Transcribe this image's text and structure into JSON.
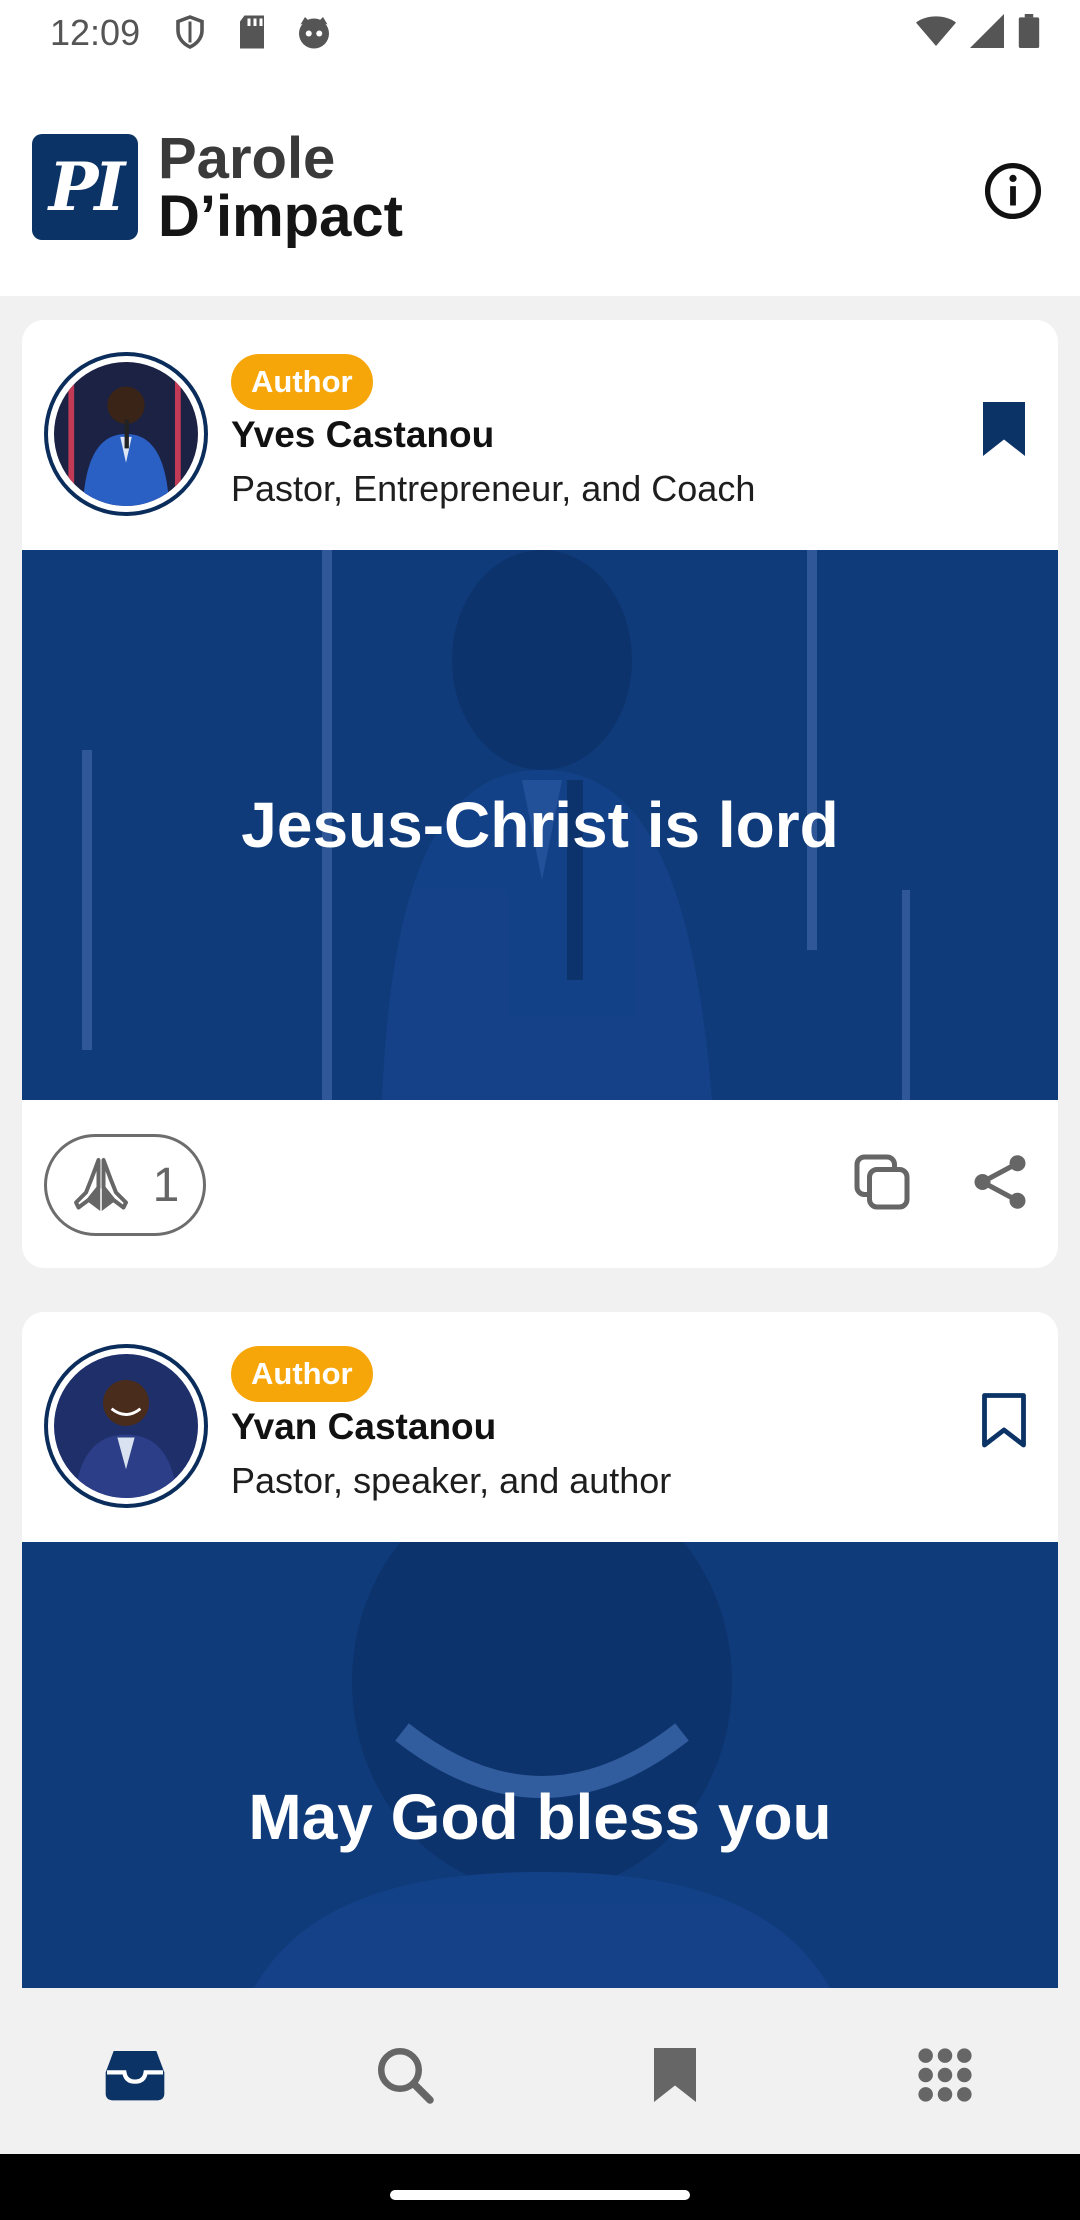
{
  "status_bar": {
    "time": "12:09"
  },
  "header": {
    "logo_mark": "PI",
    "title_line1": "Parole",
    "title_line2": "D’impact"
  },
  "feed": {
    "posts": [
      {
        "badge": "Author",
        "author_name": "Yves Castanou",
        "author_role": "Pastor, Entrepreneur, and Coach",
        "quote": "Jesus-Christ is lord",
        "bookmarked": true,
        "pray_count": "1"
      },
      {
        "badge": "Author",
        "author_name": "Yvan Castanou",
        "author_role": "Pastor, speaker, and author",
        "quote": "May God bless you",
        "bookmarked": false
      }
    ]
  },
  "bottom_nav": {
    "items": [
      "feed-icon",
      "search-icon",
      "bookmark-icon",
      "apps-grid-icon"
    ],
    "active": "feed-icon"
  },
  "colors": {
    "brand_navy": "#0b3366",
    "badge_orange": "#f7a60a",
    "quote_blue": "#0e3a78"
  }
}
